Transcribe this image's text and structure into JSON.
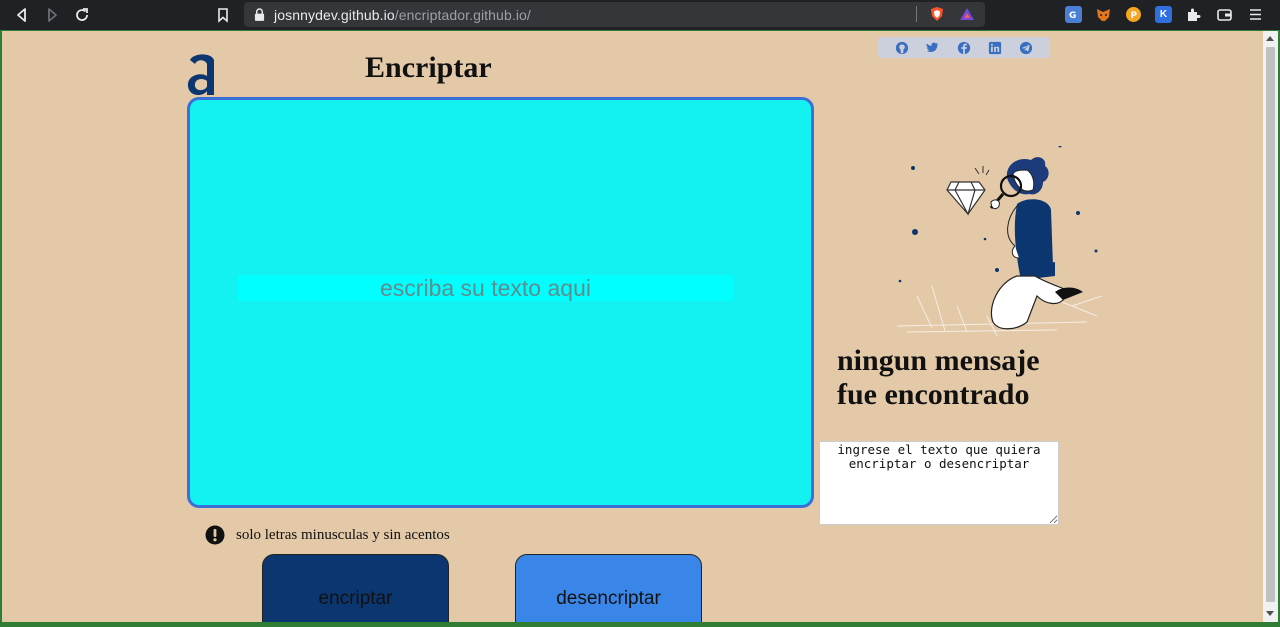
{
  "browser": {
    "url_host": "josnnydev.github.io",
    "url_path": "/encriptador.github.io/",
    "extensions": [
      {
        "name": "translate-extension-icon",
        "color": "#4a7fd6"
      },
      {
        "name": "metamask-extension-icon",
        "color": "#e2761b"
      },
      {
        "name": "coin-extension-icon",
        "color": "#f5a623"
      },
      {
        "name": "k-extension-icon",
        "label": "K",
        "color": "#2f6fe0"
      }
    ]
  },
  "page": {
    "title": "Encriptar",
    "input_placeholder": "escriba su texto aqui",
    "no_message_line1": "ningun mensaje",
    "no_message_line2": "fue encontrado",
    "output_placeholder": "ingrese el texto que quiera encriptar o desencriptar",
    "hint": "solo letras minusculas y sin acentos",
    "encrypt_label": "encriptar",
    "decrypt_label": "desencriptar"
  },
  "social": [
    "github-icon",
    "twitter-icon",
    "facebook-icon",
    "linkedin-icon",
    "telegram-icon"
  ],
  "colors": {
    "background": "#e3c9a8",
    "input_box": "#14f1f1",
    "input_border": "#3b6fd8",
    "encrypt_button": "#0b3670",
    "decrypt_button": "#3a86e8",
    "brand_dark": "#0b3670"
  }
}
